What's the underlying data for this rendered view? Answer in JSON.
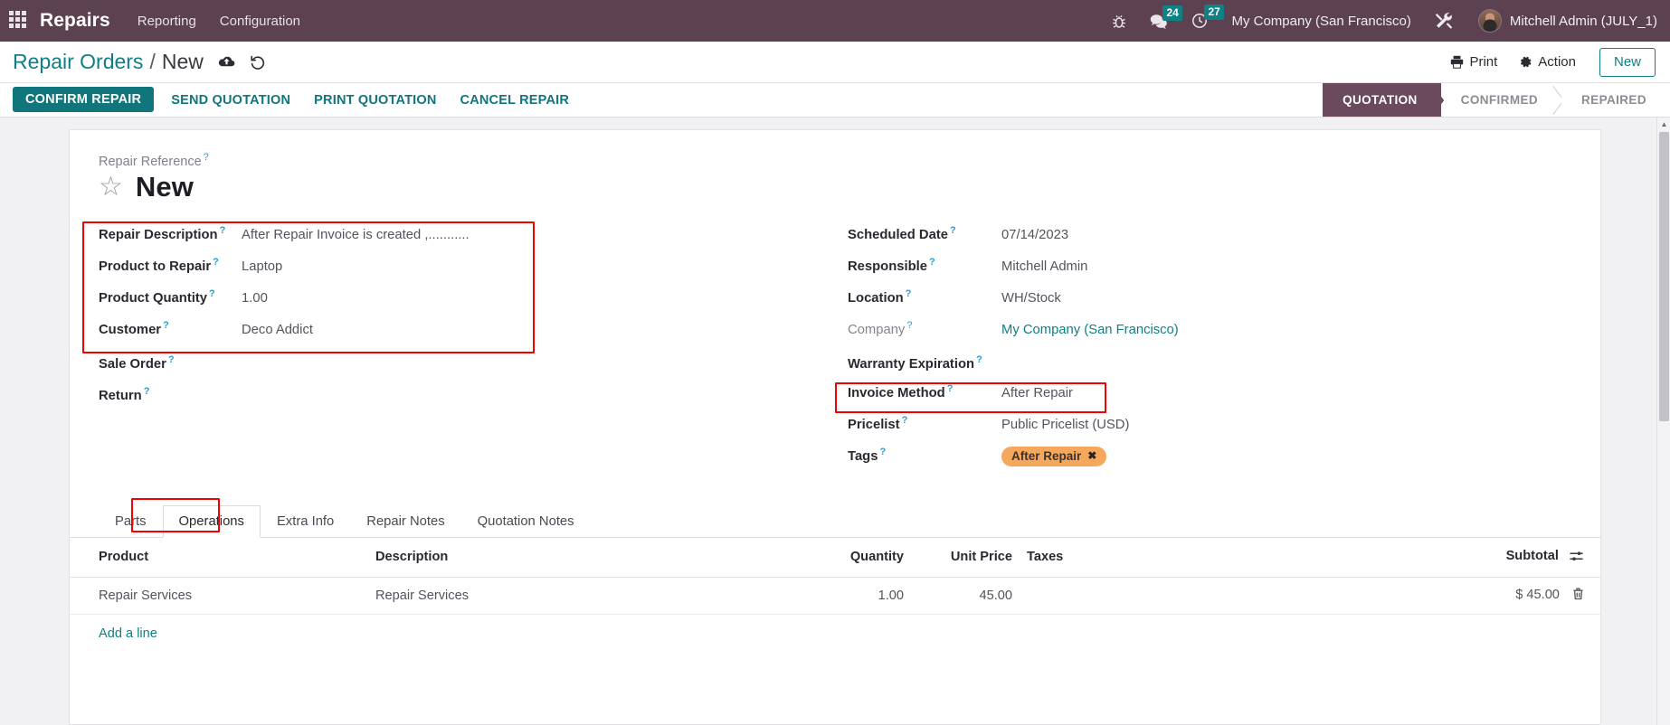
{
  "navbar": {
    "apps_icon": "apps-grid-icon",
    "brand": "Repairs",
    "menus": [
      {
        "label": "Reporting"
      },
      {
        "label": "Configuration"
      }
    ],
    "sys_icons": [
      {
        "name": "bug-icon",
        "badge": ""
      },
      {
        "name": "messages-icon",
        "badge": "24"
      },
      {
        "name": "activities-clock-icon",
        "badge": "27"
      }
    ],
    "company": "My Company (San Francisco)",
    "tools_icon": "wrench-tools-icon",
    "user": "Mitchell Admin (JULY_1)"
  },
  "breadcrumb": {
    "root": "Repair Orders",
    "separator": "/",
    "current": "New",
    "save_icon": "cloud-upload-save-icon",
    "discard_icon": "undo-discard-icon",
    "print_label": "Print",
    "action_label": "Action",
    "new_label": "New"
  },
  "statusbar": {
    "buttons": [
      {
        "label": "CONFIRM REPAIR",
        "primary": true
      },
      {
        "label": "SEND QUOTATION",
        "primary": false
      },
      {
        "label": "PRINT QUOTATION",
        "primary": false
      },
      {
        "label": "CANCEL REPAIR",
        "primary": false
      }
    ],
    "stages": [
      {
        "label": "QUOTATION",
        "active": true
      },
      {
        "label": "CONFIRMED",
        "active": false
      },
      {
        "label": "REPAIRED",
        "active": false
      }
    ]
  },
  "form": {
    "title_label": "Repair Reference",
    "title_value": "New",
    "star_icon": "favorite-star-icon",
    "left_fields": [
      {
        "label": "Repair Description",
        "value": "After Repair Invoice is created ,..........."
      },
      {
        "label": "Product to Repair",
        "value": "Laptop"
      },
      {
        "label": "Product Quantity",
        "value": "1.00"
      },
      {
        "label": "Customer",
        "value": "Deco Addict"
      },
      {
        "label": "Sale Order",
        "value": ""
      },
      {
        "label": "Return",
        "value": ""
      }
    ],
    "right_fields": [
      {
        "label": "Scheduled Date",
        "value": "07/14/2023"
      },
      {
        "label": "Responsible",
        "value": "Mitchell Admin"
      },
      {
        "label": "Location",
        "value": "WH/Stock"
      },
      {
        "label": "Company",
        "value": "My Company (San Francisco)"
      },
      {
        "label": "Warranty Expiration",
        "value": ""
      },
      {
        "label": "Invoice Method",
        "value": "After Repair"
      },
      {
        "label": "Pricelist",
        "value": "Public Pricelist (USD)"
      },
      {
        "label": "Tags",
        "value": "After Repair"
      }
    ]
  },
  "notebook": {
    "tabs": [
      {
        "label": "Parts",
        "active": false
      },
      {
        "label": "Operations",
        "active": true
      },
      {
        "label": "Extra Info",
        "active": false
      },
      {
        "label": "Repair Notes",
        "active": false
      },
      {
        "label": "Quotation Notes",
        "active": false
      }
    ],
    "columns": {
      "product": "Product",
      "description": "Description",
      "quantity": "Quantity",
      "unit_price": "Unit Price",
      "taxes": "Taxes",
      "subtotal": "Subtotal"
    },
    "optional_columns_icon": "column-options-icon",
    "rows": [
      {
        "product": "Repair Services",
        "description": "Repair Services",
        "quantity": "1.00",
        "unit_price": "45.00",
        "taxes": "",
        "subtotal": "$ 45.00",
        "delete_icon": "trash-icon"
      }
    ],
    "add_line": "Add a line"
  },
  "theme": {
    "navbar_bg": "#5c4251",
    "primary": "#11757c",
    "link": "#0f7e85",
    "stage_active_bg": "#6a4a5c",
    "tag_bg": "#f5a85b",
    "annotation": "#f40000",
    "badge_bg": "#0e8185"
  }
}
